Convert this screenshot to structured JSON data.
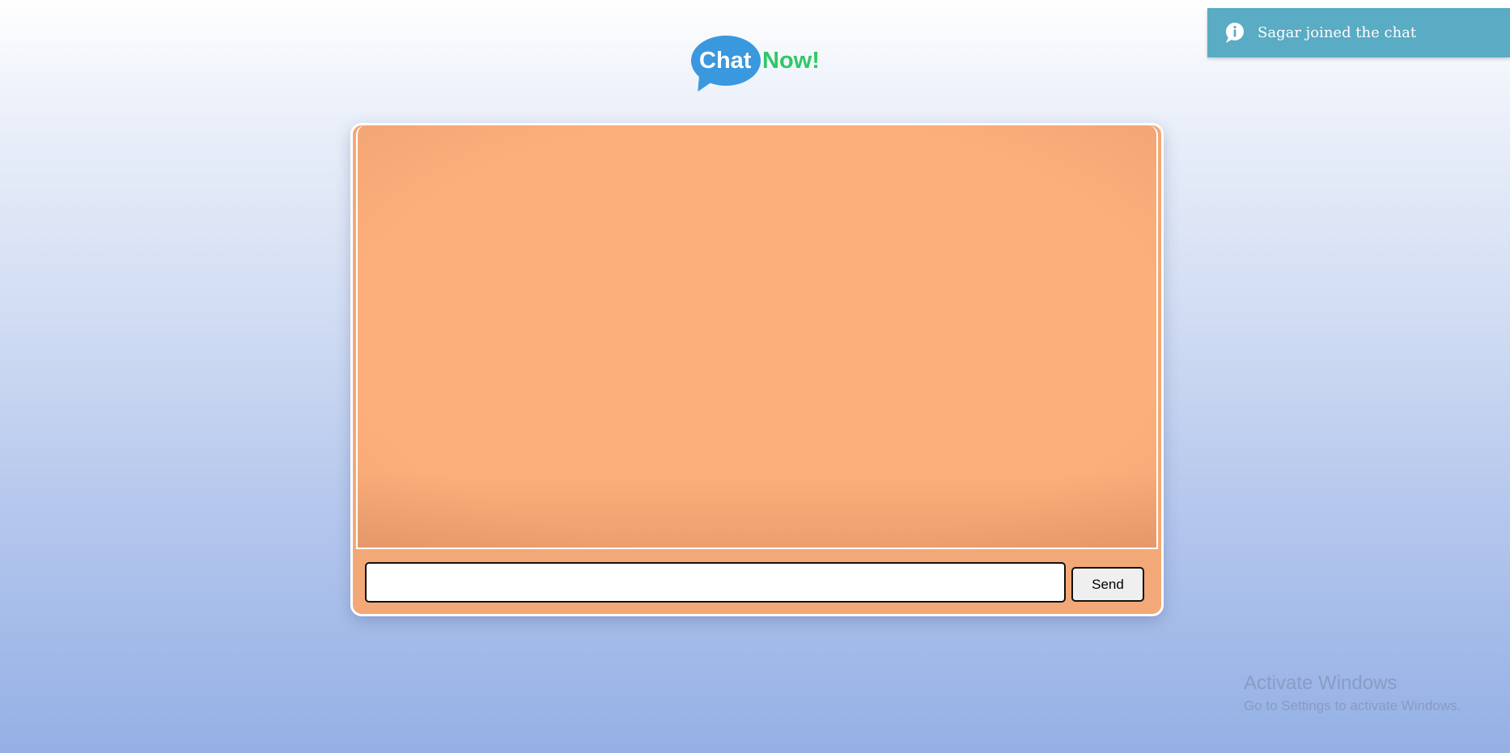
{
  "logo": {
    "chat_text": "Chat",
    "now_text": "Now!",
    "colors": {
      "bubble": "#3a98de",
      "now": "#2ec866"
    }
  },
  "chat": {
    "messages": [],
    "input_value": "",
    "send_label": "Send",
    "colors": {
      "background": "#fcaf7b",
      "border": "#ffffff"
    }
  },
  "toast": {
    "icon": "info-icon",
    "message": "Sagar joined the chat",
    "color": "#5aabc4"
  },
  "watermark": {
    "title": "Activate Windows",
    "subtitle": "Go to Settings to activate Windows."
  }
}
